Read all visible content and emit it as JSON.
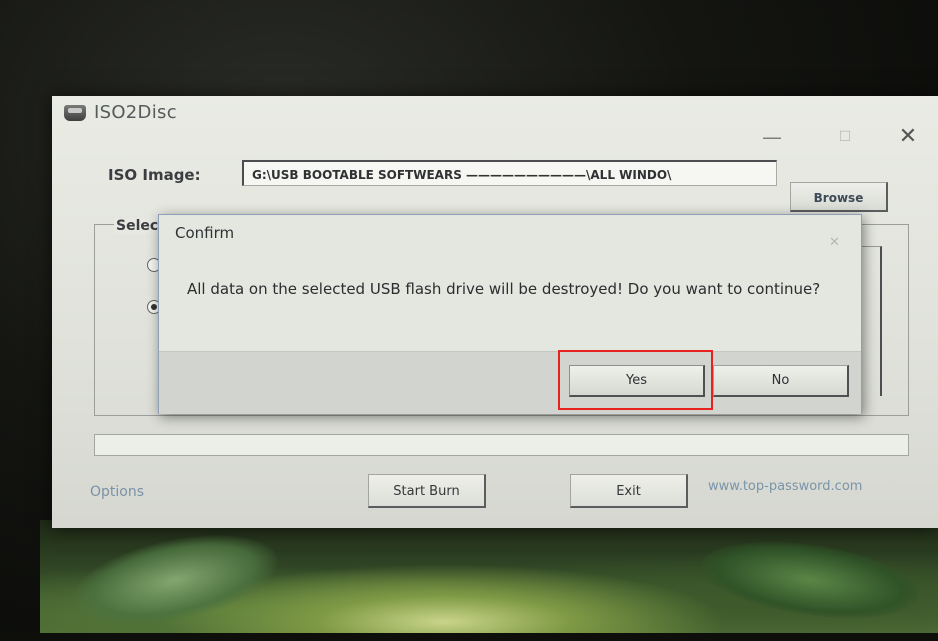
{
  "app": {
    "title": "ISO2Disc",
    "minimize_glyph": "—",
    "maximize_glyph": "☐",
    "close_glyph": "✕"
  },
  "iso": {
    "label": "ISO Image:",
    "path": "G:\\USB BOOTABLE  SOFTWEARS ——————————\\ALL WINDO\\",
    "browse_label": "Browse"
  },
  "select_group": {
    "label": "Selec"
  },
  "footer": {
    "options_label": "Options",
    "start_burn_label": "Start Burn",
    "exit_label": "Exit",
    "site_link": "www.top-password.com"
  },
  "dialog": {
    "title": "Confirm",
    "close_glyph": "✕",
    "message": "All data on the selected USB flash drive will be destroyed! Do you want to continue?",
    "yes_label": "Yes",
    "no_label": "No"
  },
  "colors": {
    "highlight": "#e8231f",
    "link": "#7a94aa",
    "window_bg": "#e4e6e0"
  },
  "icons": {
    "app_icon": "drive-icon"
  }
}
